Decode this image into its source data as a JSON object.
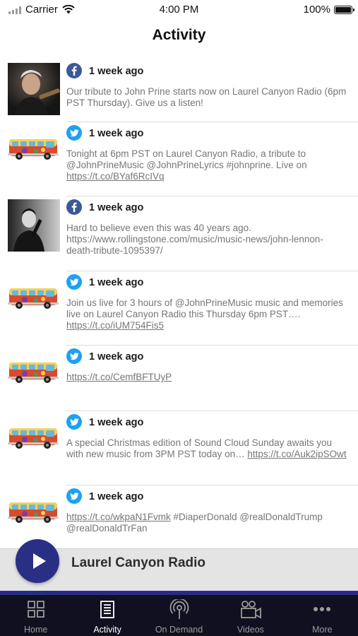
{
  "status_bar": {
    "carrier": "Carrier",
    "time": "4:00 PM",
    "battery": "100%"
  },
  "header": {
    "title": "Activity"
  },
  "feed": [
    {
      "source": "facebook",
      "thumb": "john-prine-photo",
      "time": "1 week ago",
      "text": "Our tribute to John Prine starts now on Laurel Canyon Radio (6pm PST Thursday).  Give us a listen!",
      "link": ""
    },
    {
      "source": "twitter",
      "thumb": "bus-logo",
      "time": "1 week ago",
      "text": "Tonight at 6pm PST on Laurel Canyon Radio, a tribute to @JohnPrineMusic @JohnPrineLyrics #johnprine.  Live on ",
      "link": "https://t.co/BYaf6RcIVq"
    },
    {
      "source": "facebook",
      "thumb": "john-lennon-photo",
      "time": "1 week ago",
      "text": "Hard to believe even this was 40 years ago.  https://www.rollingstone.com/music/music-news/john-lennon-death-tribute-1095397/",
      "link": ""
    },
    {
      "source": "twitter",
      "thumb": "bus-logo",
      "time": "1 week ago",
      "text": "Join us live for 3 hours of @JohnPrineMusic  music and memories live on Laurel Canyon Radio this Thursday 6pm PST…. ",
      "link": "https://t.co/iUM754Fis5"
    },
    {
      "source": "twitter",
      "thumb": "bus-logo",
      "time": "1 week ago",
      "text": "",
      "link": "https://t.co/CemfBFTUyP"
    },
    {
      "source": "twitter",
      "thumb": "bus-logo",
      "time": "1 week ago",
      "text": "A special Christmas edition of Sound Cloud Sunday awaits you with new music from 3PM PST today on… ",
      "link": "https://t.co/Auk2ipSOwt"
    },
    {
      "source": "twitter",
      "thumb": "bus-logo",
      "time": "1 week ago",
      "text": " #DiaperDonald @realDonaldTrump @realDonaldTrFan",
      "link": "https://t.co/wkpaN1Fvmk",
      "link_first": true
    }
  ],
  "player": {
    "station": "Laurel Canyon Radio",
    "icon": "play-icon"
  },
  "tabs": [
    {
      "label": "Home",
      "icon": "grid-icon",
      "active": false
    },
    {
      "label": "Activity",
      "icon": "newspaper-icon",
      "active": true
    },
    {
      "label": "On Demand",
      "icon": "podcast-icon",
      "active": false
    },
    {
      "label": "Videos",
      "icon": "video-camera-icon",
      "active": false
    },
    {
      "label": "More",
      "icon": "more-dots-icon",
      "active": false
    }
  ],
  "colors": {
    "accent": "#2a2f86",
    "tab_bar": "#101020",
    "facebook": "#3b5998",
    "twitter": "#1da1f2"
  }
}
